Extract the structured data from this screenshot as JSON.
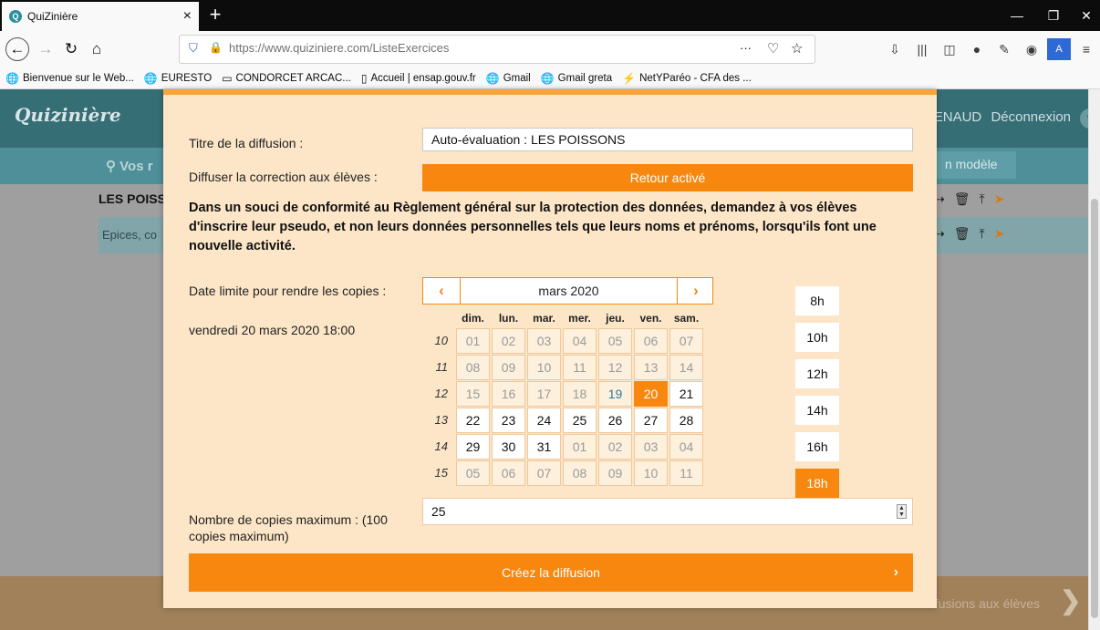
{
  "browser": {
    "tab_title": "QuiZinière",
    "tab_close": "×",
    "new_tab": "+",
    "url": "https://www.quiziniere.com/ListeExercices",
    "url_more": "···",
    "bookmarks": [
      {
        "icon": "🌐",
        "label": "Bienvenue sur le Web..."
      },
      {
        "icon": "🌐",
        "label": "EURESTO"
      },
      {
        "icon": "▭",
        "label": "CONDORCET ARCAC..."
      },
      {
        "icon": "▯",
        "label": "Accueil | ensap.gouv.fr"
      },
      {
        "icon": "🌐",
        "label": "Gmail"
      },
      {
        "icon": "🌐",
        "label": "Gmail greta"
      },
      {
        "icon": "⚡",
        "label": "NetYParéo - CFA des ..."
      }
    ]
  },
  "app": {
    "logo": "Quizinière",
    "user_fragment": "ENAUD",
    "logout": "Déconnexion",
    "help": "?",
    "search_fragment": "Vos r",
    "model_fragment": "n modèle",
    "row1_fragment": "LES POISS",
    "row2_fragment": "Epices, co",
    "footer_fragment": "Diffusions aux élèves",
    "footer_arrow": "❯"
  },
  "modal": {
    "title_label": "Titre de la diffusion :",
    "title_value": "Auto-évaluation : LES POISSONS",
    "correction_label": "Diffuser la correction aux élèves :",
    "correction_button": "Retour activé",
    "gdpr_notice": "Dans un souci de conformité au Règlement général sur la protection des données, demandez à vos élèves d'inscrire leur pseudo, et non leurs données personnelles tels que leurs noms et prénoms, lorsqu'ils font une nouvelle activité.",
    "deadline_label": "Date limite pour rendre les copies :",
    "deadline_value": "vendredi 20 mars 2020 18:00",
    "calendar": {
      "month": "mars 2020",
      "prev": "‹",
      "next": "›",
      "weekdays": [
        "dim.",
        "lun.",
        "mar.",
        "mer.",
        "jeu.",
        "ven.",
        "sam."
      ],
      "weeks": [
        {
          "num": "10",
          "days": [
            {
              "d": "01",
              "s": "dim"
            },
            {
              "d": "02",
              "s": "dim"
            },
            {
              "d": "03",
              "s": "dim"
            },
            {
              "d": "04",
              "s": "dim"
            },
            {
              "d": "05",
              "s": "dim"
            },
            {
              "d": "06",
              "s": "dim"
            },
            {
              "d": "07",
              "s": "dim"
            }
          ]
        },
        {
          "num": "11",
          "days": [
            {
              "d": "08",
              "s": "dim"
            },
            {
              "d": "09",
              "s": "dim"
            },
            {
              "d": "10",
              "s": "dim"
            },
            {
              "d": "11",
              "s": "dim"
            },
            {
              "d": "12",
              "s": "dim"
            },
            {
              "d": "13",
              "s": "dim"
            },
            {
              "d": "14",
              "s": "dim"
            }
          ]
        },
        {
          "num": "12",
          "days": [
            {
              "d": "15",
              "s": "dim"
            },
            {
              "d": "16",
              "s": "dim"
            },
            {
              "d": "17",
              "s": "dim"
            },
            {
              "d": "18",
              "s": "dim"
            },
            {
              "d": "19",
              "s": "today"
            },
            {
              "d": "20",
              "s": "sel"
            },
            {
              "d": "21",
              "s": "cur"
            }
          ]
        },
        {
          "num": "13",
          "days": [
            {
              "d": "22",
              "s": "cur"
            },
            {
              "d": "23",
              "s": "cur"
            },
            {
              "d": "24",
              "s": "cur"
            },
            {
              "d": "25",
              "s": "cur"
            },
            {
              "d": "26",
              "s": "cur"
            },
            {
              "d": "27",
              "s": "cur"
            },
            {
              "d": "28",
              "s": "cur"
            }
          ]
        },
        {
          "num": "14",
          "days": [
            {
              "d": "29",
              "s": "cur"
            },
            {
              "d": "30",
              "s": "cur"
            },
            {
              "d": "31",
              "s": "cur"
            },
            {
              "d": "01",
              "s": "dim"
            },
            {
              "d": "02",
              "s": "dim"
            },
            {
              "d": "03",
              "s": "dim"
            },
            {
              "d": "04",
              "s": "dim"
            }
          ]
        },
        {
          "num": "15",
          "days": [
            {
              "d": "05",
              "s": "dim"
            },
            {
              "d": "06",
              "s": "dim"
            },
            {
              "d": "07",
              "s": "dim"
            },
            {
              "d": "08",
              "s": "dim"
            },
            {
              "d": "09",
              "s": "dim"
            },
            {
              "d": "10",
              "s": "dim"
            },
            {
              "d": "11",
              "s": "dim"
            }
          ]
        }
      ]
    },
    "hours": [
      {
        "label": "8h",
        "selected": false
      },
      {
        "label": "10h",
        "selected": false
      },
      {
        "label": "12h",
        "selected": false
      },
      {
        "label": "14h",
        "selected": false
      },
      {
        "label": "16h",
        "selected": false
      },
      {
        "label": "18h",
        "selected": true
      }
    ],
    "max_copies_label": "Nombre de copies maximum : (100 copies maximum)",
    "max_copies_value": "25",
    "create_button": "Créez la diffusion",
    "create_arrow": "›"
  },
  "colors": {
    "accent": "#f7870f",
    "modal_bg": "#fce6c7",
    "header": "#366e76"
  }
}
